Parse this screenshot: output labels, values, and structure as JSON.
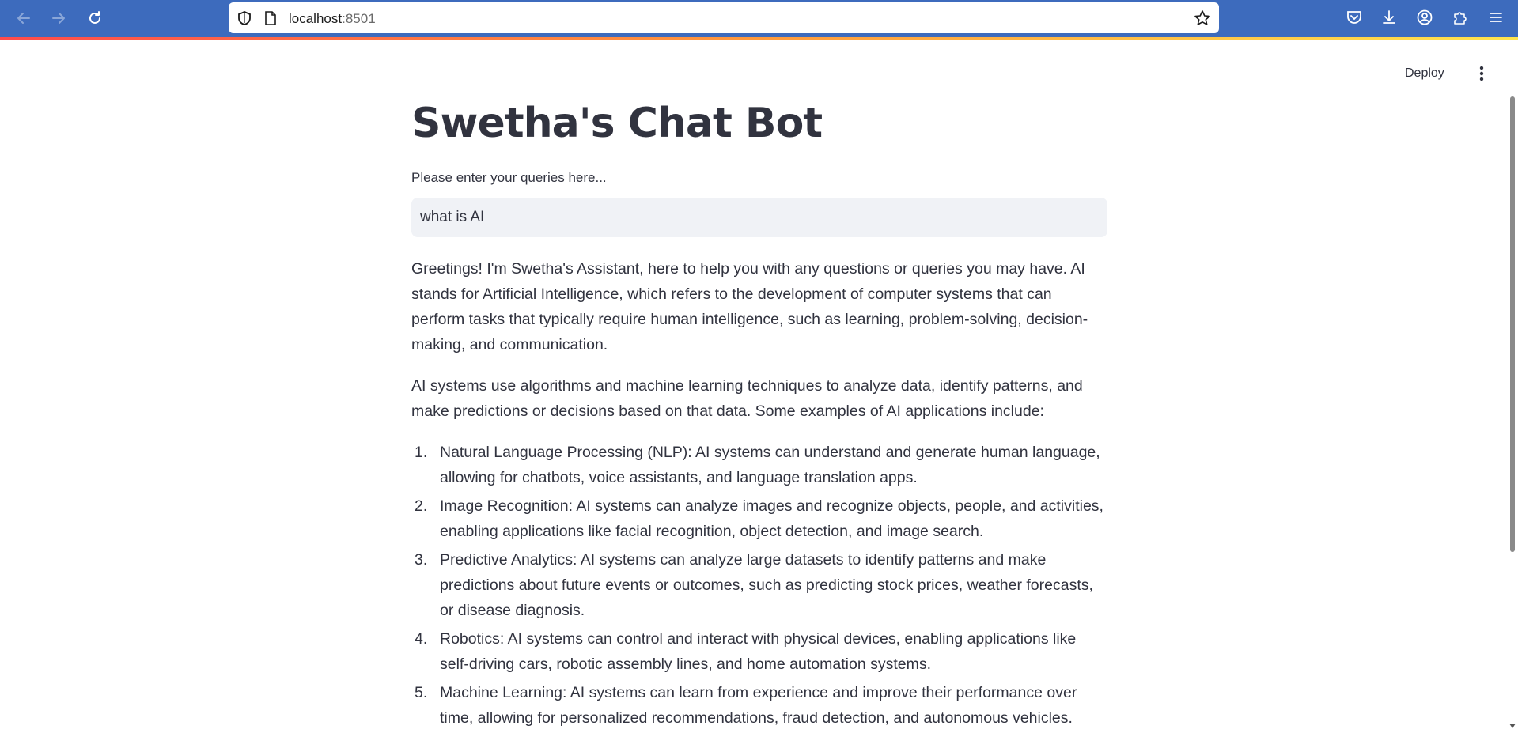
{
  "browser": {
    "url_host": "localhost",
    "url_port": ":8501"
  },
  "header": {
    "deploy_label": "Deploy"
  },
  "main": {
    "title": "Swetha's Chat Bot",
    "input_label": "Please enter your queries here...",
    "input_value": "what is AI",
    "paragraphs": [
      "Greetings! I'm Swetha's Assistant, here to help you with any questions or queries you may have. AI stands for Artificial Intelligence, which refers to the development of computer systems that can perform tasks that typically require human intelligence, such as learning, problem-solving, decision-making, and communication.",
      "AI systems use algorithms and machine learning techniques to analyze data, identify patterns, and make predictions or decisions based on that data. Some examples of AI applications include:"
    ],
    "list": [
      {
        "num": "1.",
        "text": "Natural Language Processing (NLP): AI systems can understand and generate human language, allowing for chatbots, voice assistants, and language translation apps."
      },
      {
        "num": "2.",
        "text": "Image Recognition: AI systems can analyze images and recognize objects, people, and activities, enabling applications like facial recognition, object detection, and image search."
      },
      {
        "num": "3.",
        "text": "Predictive Analytics: AI systems can analyze large datasets to identify patterns and make predictions about future events or outcomes, such as predicting stock prices, weather forecasts, or disease diagnosis."
      },
      {
        "num": "4.",
        "text": "Robotics: AI systems can control and interact with physical devices, enabling applications like self-driving cars, robotic assembly lines, and home automation systems."
      },
      {
        "num": "5.",
        "text": "Machine Learning: AI systems can learn from experience and improve their performance over time, allowing for personalized recommendations, fraud detection, and autonomous vehicles."
      }
    ]
  },
  "icons": {
    "back": "arrow-left-icon",
    "forward": "arrow-right-icon",
    "reload": "reload-icon",
    "shield": "shield-icon",
    "page": "page-icon",
    "bookmark": "star-icon",
    "pocket": "pocket-icon",
    "downloads": "download-icon",
    "account": "account-icon",
    "extensions": "puzzle-icon",
    "menu": "hamburger-menu-icon",
    "app_menu": "kebab-menu-icon"
  },
  "colors": {
    "browser_bar": "#3d6bbd",
    "input_bg": "#f0f2f6",
    "text": "#31333f"
  }
}
